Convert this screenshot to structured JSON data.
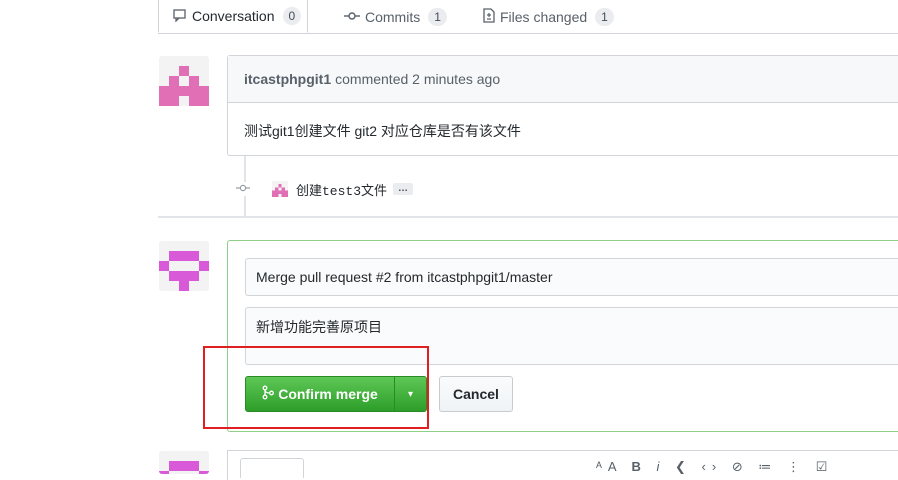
{
  "tabs": [
    {
      "label": "Conversation",
      "count": "0",
      "icon": "comment-icon"
    },
    {
      "label": "Commits",
      "count": "1",
      "icon": "commit-icon"
    },
    {
      "label": "Files changed",
      "count": "1",
      "icon": "file-diff-icon"
    }
  ],
  "comment": {
    "author": "itcastphpgit1",
    "action": "commented 2 minutes ago",
    "body": "测试git1创建文件 git2 对应仓库是否有该文件"
  },
  "commit": {
    "message": "创建test3文件",
    "ellipsis": "…"
  },
  "merge": {
    "title_value": "Merge pull request #2 from itcastphpgit1/master",
    "body_value": "新增功能完善原项目",
    "confirm_label": "Confirm merge",
    "cancel_label": "Cancel"
  },
  "colors": {
    "accent_green": "#2ea44f",
    "highlight_red": "#e02020",
    "identicon_pink": "#e06fb5",
    "identicon_magenta": "#d85ad8"
  }
}
